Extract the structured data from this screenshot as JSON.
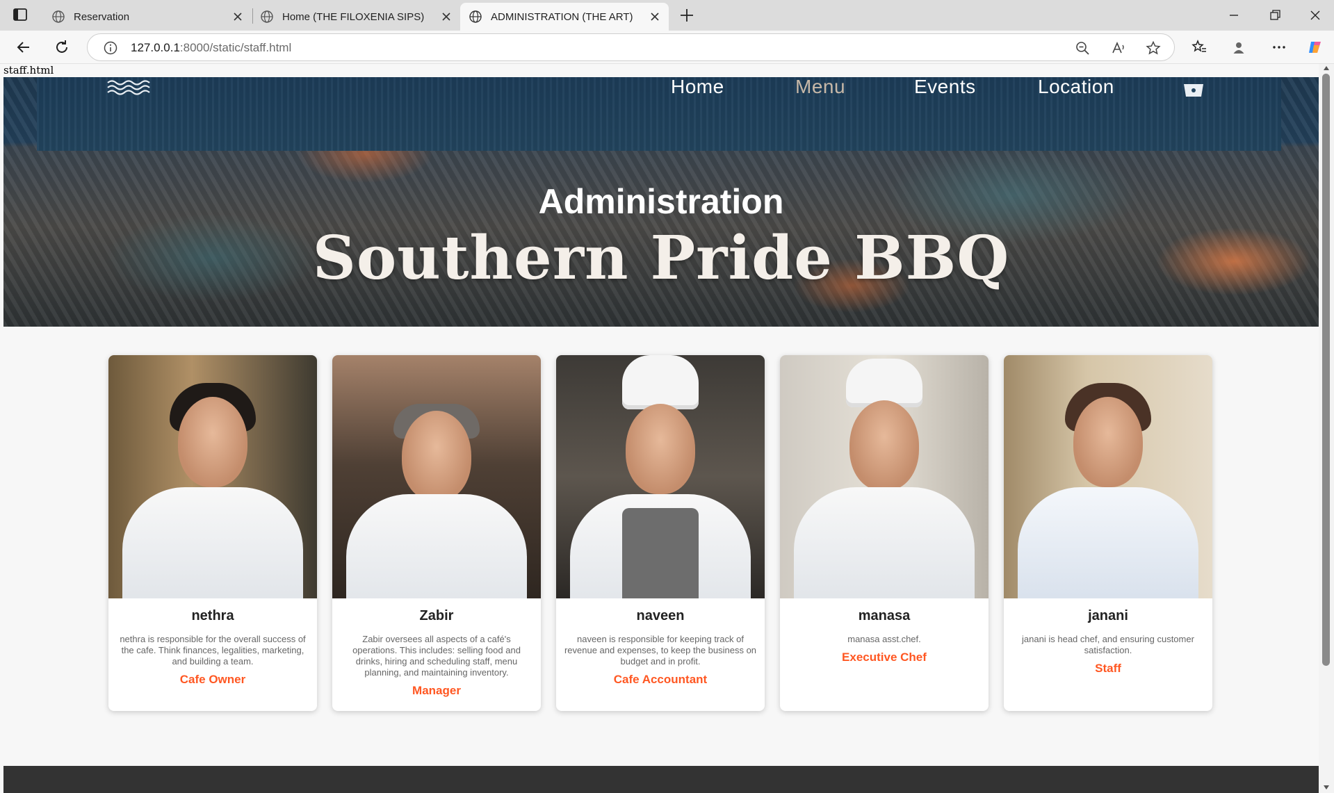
{
  "browser": {
    "tabs": [
      {
        "title": "Reservation",
        "active": false
      },
      {
        "title": "Home (THE FILOXENIA SIPS)",
        "active": false
      },
      {
        "title": "ADMINISTRATION (THE ART)",
        "active": true
      }
    ],
    "url_host": "127.0.0.1",
    "url_rest": ":8000/static/staff.html"
  },
  "page": {
    "file_label": "staff.html",
    "nav": {
      "home": "Home",
      "menu": "Menu",
      "events": "Events",
      "location": "Location"
    },
    "hero_heading": "Administration",
    "hero_brand": "Southern Pride BBQ"
  },
  "staff": [
    {
      "name": "nethra",
      "description": "nethra is responsible for the overall success of the cafe. Think finances, legalities, marketing, and building a team.",
      "role": "Cafe Owner"
    },
    {
      "name": "Zabir",
      "description": "Zabir oversees all aspects of a café's operations. This includes: selling food and drinks, hiring and scheduling staff, menu planning, and maintaining inventory.",
      "role": "Manager"
    },
    {
      "name": "naveen",
      "description": "naveen is responsible for keeping track of revenue and expenses, to keep the business on budget and in profit.",
      "role": "Cafe Accountant"
    },
    {
      "name": "manasa",
      "description": "manasa asst.chef.",
      "role": "Executive Chef"
    },
    {
      "name": "janani",
      "description": "janani is head chef, and ensuring customer satisfaction.",
      "role": "Staff"
    }
  ],
  "colors": {
    "accent": "#ff5722",
    "footer": "#333333"
  }
}
